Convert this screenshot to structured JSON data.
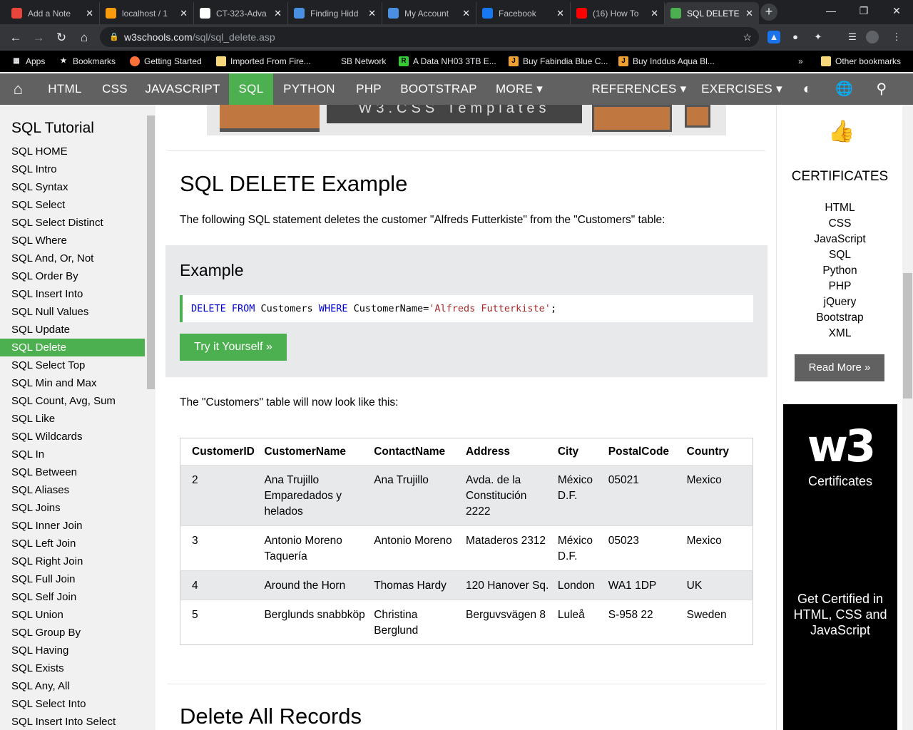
{
  "browser": {
    "tabs": [
      {
        "title": "Add a Note",
        "icon": "addanote-icon",
        "color": "#e8453c"
      },
      {
        "title": "localhost / 1",
        "icon": "phpmyadmin-icon",
        "color": "#f89c0e"
      },
      {
        "title": "CT-323-Adva",
        "icon": "github-icon",
        "color": "#ffffff"
      },
      {
        "title": "Finding Hidd",
        "icon": "site-icon",
        "color": "#4a90e2"
      },
      {
        "title": "My Account",
        "icon": "account-icon",
        "color": "#4a90e2"
      },
      {
        "title": "Facebook",
        "icon": "facebook-icon",
        "color": "#1877f2"
      },
      {
        "title": "(16) How To",
        "icon": "youtube-icon",
        "color": "#ff0000"
      },
      {
        "title": "SQL DELETE",
        "icon": "w3schools-icon",
        "color": "#4caf50"
      }
    ],
    "active_tab": 7,
    "url_host": "w3schools.com",
    "url_path": "/sql/sql_delete.asp",
    "bookmarks": [
      {
        "label": "Apps",
        "icon": "apps-grid-icon"
      },
      {
        "label": "Bookmarks",
        "icon": "star-icon"
      },
      {
        "label": "Getting Started",
        "icon": "firefox-icon"
      },
      {
        "label": "Imported From Fire...",
        "icon": "folder-icon"
      },
      {
        "label": "SB Network",
        "icon": "none"
      },
      {
        "label": "A Data NH03 3TB E...",
        "icon": "r-icon"
      },
      {
        "label": "Buy Fabindia Blue C...",
        "icon": "j-icon"
      },
      {
        "label": "Buy Inddus Aqua Bl...",
        "icon": "j-icon"
      }
    ],
    "overflow": "»",
    "other_bookmarks": "Other bookmarks"
  },
  "nav": {
    "home": "⌂",
    "items": [
      "HTML",
      "CSS",
      "JAVASCRIPT",
      "SQL",
      "PYTHON",
      "PHP",
      "BOOTSTRAP",
      "MORE ▾"
    ],
    "active": "SQL",
    "right_items": [
      "REFERENCES ▾",
      "EXERCISES ▾"
    ],
    "accent": "#4CAF50"
  },
  "sidebar": {
    "title": "SQL Tutorial",
    "items": [
      "SQL HOME",
      "SQL Intro",
      "SQL Syntax",
      "SQL Select",
      "SQL Select Distinct",
      "SQL Where",
      "SQL And, Or, Not",
      "SQL Order By",
      "SQL Insert Into",
      "SQL Null Values",
      "SQL Update",
      "SQL Delete",
      "SQL Select Top",
      "SQL Min and Max",
      "SQL Count, Avg, Sum",
      "SQL Like",
      "SQL Wildcards",
      "SQL In",
      "SQL Between",
      "SQL Aliases",
      "SQL Joins",
      "SQL Inner Join",
      "SQL Left Join",
      "SQL Right Join",
      "SQL Full Join",
      "SQL Self Join",
      "SQL Union",
      "SQL Group By",
      "SQL Having",
      "SQL Exists",
      "SQL Any, All",
      "SQL Select Into",
      "SQL Insert Into Select"
    ],
    "active_index": 11
  },
  "main": {
    "banner_text": "W3.CSS Templates",
    "heading": "SQL DELETE Example",
    "intro": "The following SQL statement deletes the customer \"Alfreds Futterkiste\" from the \"Customers\" table:",
    "example_title": "Example",
    "code": {
      "kw1": "DELETE FROM",
      "t1": " Customers ",
      "kw2": "WHERE",
      "t2": " CustomerName=",
      "str": "'Alfreds Futterkiste'",
      "end": ";"
    },
    "try_button": "Try it Yourself »",
    "after_text": "The \"Customers\" table will now look like this:",
    "table": {
      "headers": [
        "CustomerID",
        "CustomerName",
        "ContactName",
        "Address",
        "City",
        "PostalCode",
        "Country"
      ],
      "rows": [
        [
          "2",
          "Ana Trujillo Emparedados y helados",
          "Ana Trujillo",
          "Avda. de la Constitución 2222",
          "México D.F.",
          "05021",
          "Mexico"
        ],
        [
          "3",
          "Antonio Moreno Taquería",
          "Antonio Moreno",
          "Mataderos 2312",
          "México D.F.",
          "05023",
          "Mexico"
        ],
        [
          "4",
          "Around the Horn",
          "Thomas Hardy",
          "120 Hanover Sq.",
          "London",
          "WA1 1DP",
          "UK"
        ],
        [
          "5",
          "Berglunds snabbköp",
          "Christina Berglund",
          "Berguvsvägen 8",
          "Luleå",
          "S-958 22",
          "Sweden"
        ]
      ]
    },
    "next_heading": "Delete All Records"
  },
  "right": {
    "cert_title": "CERTIFICATES",
    "cert_links": [
      "HTML",
      "CSS",
      "JavaScript",
      "SQL",
      "Python",
      "PHP",
      "jQuery",
      "Bootstrap",
      "XML"
    ],
    "read_more": "Read More »",
    "ad_logo": "w3",
    "ad_caption": "Certificates",
    "ad_pitch": "Get Certified in HTML, CSS and JavaScript"
  }
}
